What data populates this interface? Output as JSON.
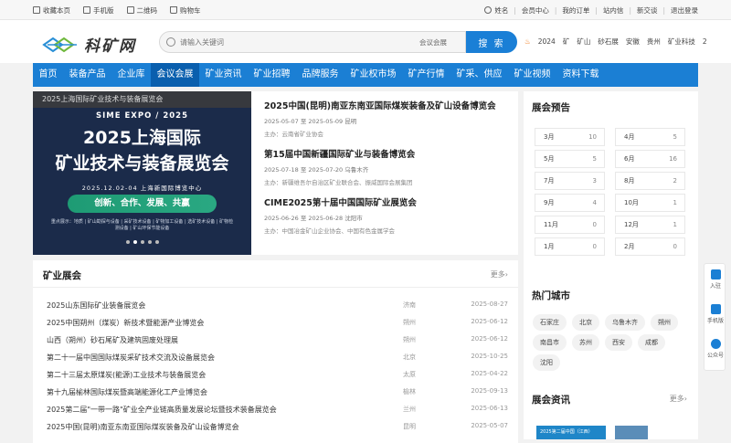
{
  "topbar": {
    "left": [
      "收藏本页",
      "手机版",
      "二维码",
      "购物车"
    ],
    "right": [
      "姓名",
      "会员中心",
      "我的订单",
      "站内信",
      "新交谈",
      "退出登录"
    ]
  },
  "logo": {
    "text": "科矿网"
  },
  "search": {
    "placeholder": "请输入关键词",
    "category": "会议会展",
    "button": "搜 索"
  },
  "hot": {
    "items": [
      "2024",
      "矿",
      "矿山",
      "砂石展",
      "安徽",
      "贵州",
      "矿业科技",
      "2"
    ]
  },
  "nav": {
    "items": [
      "首页",
      "装备产品",
      "企业库",
      "会议会展",
      "矿业资讯",
      "矿业招聘",
      "品牌服务",
      "矿业权市场",
      "矿产行情",
      "矿采、供应",
      "矿业视频",
      "资料下载"
    ],
    "active_index": 3
  },
  "banner": {
    "caption": "2025上海国际矿业技术与装备展览会",
    "expo": "SIME EXPO / 2025",
    "title1": "2025上海国际",
    "title2": "矿业技术与装备展览会",
    "date": "2025.12.02-04 上海新国际博览中心",
    "slogan": "创新、合作、发展、共赢",
    "note": "重点展示：地质 | 矿山勘探与设备 | 采矿技术设备 | 矿物加工设备 | 选矿技术设备 | 矿物检测设备 | 矿山环保节能设备"
  },
  "featured": [
    {
      "title": "2025中国(昆明)南亚东南亚国际煤炭装备及矿山设备博览会",
      "date": "2025-05-07 至 2025-05-09 昆明",
      "org": "主办：云南省矿业协会"
    },
    {
      "title": "第15届中国新疆国际矿业与装备博览会",
      "date": "2025-07-18 至 2025-07-20 乌鲁木齐",
      "org": "主办：新疆维吾尔自治区矿业联合会、振威国际会展集团"
    },
    {
      "title": "CIME2025第十届中国国际矿业展览会",
      "date": "2025-06-26 至 2025-06-28 沈阳市",
      "org": "主办：中国冶金矿山企业协会、中国有色金属学会"
    }
  ],
  "mine": {
    "title": "矿业展会",
    "more": "更多",
    "rows": [
      {
        "name": "2025山东国际矿业装备展览会",
        "city": "济南",
        "date": "2025-08-27"
      },
      {
        "name": "2025中国朔州（煤炭）新技术暨能源产业博览会",
        "city": "朔州",
        "date": "2025-06-12"
      },
      {
        "name": "山西（朔州）砂石尾矿及建筑固废处理展",
        "city": "朔州",
        "date": "2025-06-12"
      },
      {
        "name": "第二十一届中国国际煤炭采矿技术交流及设备展览会",
        "city": "北京",
        "date": "2025-10-25"
      },
      {
        "name": "第二十三届太原煤炭(能源)工业技术与装备展览会",
        "city": "太原",
        "date": "2025-04-22"
      },
      {
        "name": "第十九届榆林国际煤炭暨高端能源化工产业博览会",
        "city": "榆林",
        "date": "2025-09-13"
      },
      {
        "name": "2025第二届\"一带一路\"矿业全产业链高质量发展论坛暨技术装备展览会",
        "city": "兰州",
        "date": "2025-06-13"
      },
      {
        "name": "2025中国(昆明)南亚东南亚国际煤炭装备及矿山设备博览会",
        "city": "昆明",
        "date": "2025-05-07"
      }
    ]
  },
  "preview": {
    "title": "展会预告",
    "months": [
      {
        "m": "3月",
        "n": "10"
      },
      {
        "m": "4月",
        "n": "5"
      },
      {
        "m": "5月",
        "n": "5"
      },
      {
        "m": "6月",
        "n": "16"
      },
      {
        "m": "7月",
        "n": "3"
      },
      {
        "m": "8月",
        "n": "2"
      },
      {
        "m": "9月",
        "n": "4"
      },
      {
        "m": "10月",
        "n": "1"
      },
      {
        "m": "11月",
        "n": "0"
      },
      {
        "m": "12月",
        "n": "1"
      },
      {
        "m": "1月",
        "n": "0"
      },
      {
        "m": "2月",
        "n": "0"
      }
    ]
  },
  "cities": {
    "title": "热门城市",
    "items": [
      "石家庄",
      "北京",
      "乌鲁木齐",
      "朔州",
      "南昌市",
      "苏州",
      "西安",
      "成都",
      "沈阳"
    ]
  },
  "newsbox": {
    "title": "展会资讯",
    "more": "更多",
    "thumbs": [
      "2025第二届中国（江西）",
      "",
      ""
    ]
  },
  "floatbar": {
    "items": [
      "入驻",
      "手机版",
      "公众号"
    ]
  }
}
